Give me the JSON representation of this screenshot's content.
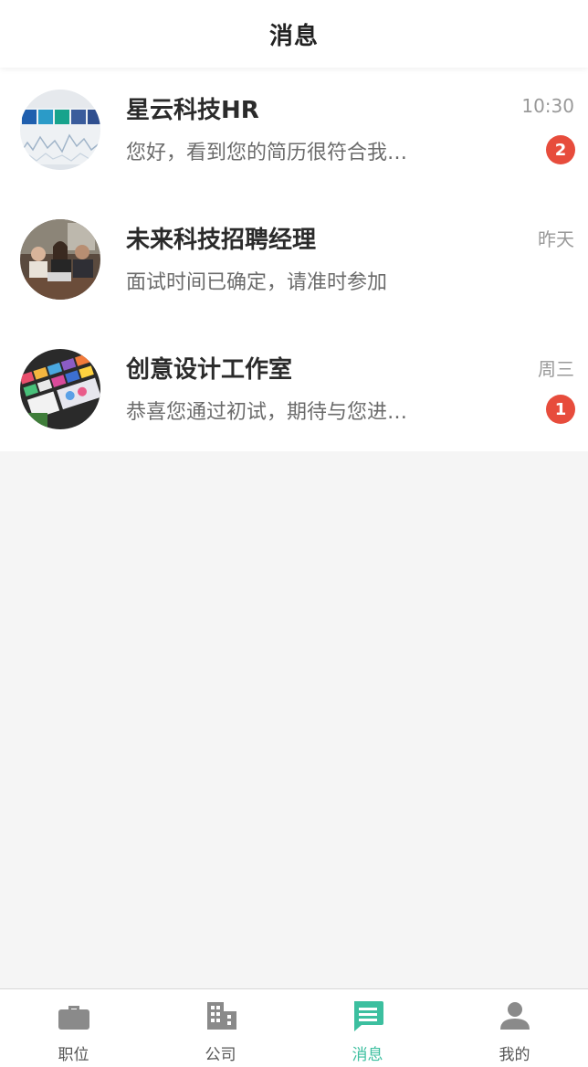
{
  "header": {
    "title": "消息"
  },
  "conversations": [
    {
      "name": "星云科技HR",
      "preview": "您好，看到您的简历很符合我…",
      "time": "10:30",
      "unread": "2",
      "avatar": "dashboard-photo"
    },
    {
      "name": "未来科技招聘经理",
      "preview": "面试时间已确定，请准时参加",
      "time": "昨天",
      "unread": "",
      "avatar": "office-team-photo"
    },
    {
      "name": "创意设计工作室",
      "preview": "恭喜您通过初试，期待与您进…",
      "time": "周三",
      "unread": "1",
      "avatar": "design-swatches-photo"
    }
  ],
  "tabbar": {
    "active": "messages",
    "items": [
      {
        "key": "jobs",
        "label": "职位",
        "icon": "briefcase-icon"
      },
      {
        "key": "company",
        "label": "公司",
        "icon": "building-icon"
      },
      {
        "key": "messages",
        "label": "消息",
        "icon": "chat-icon"
      },
      {
        "key": "me",
        "label": "我的",
        "icon": "person-icon"
      }
    ]
  },
  "colors": {
    "accent": "#3cbf9f",
    "badge": "#e74c3c",
    "tab_inactive_icon": "#8a8a8a",
    "background": "#f5f5f5"
  }
}
